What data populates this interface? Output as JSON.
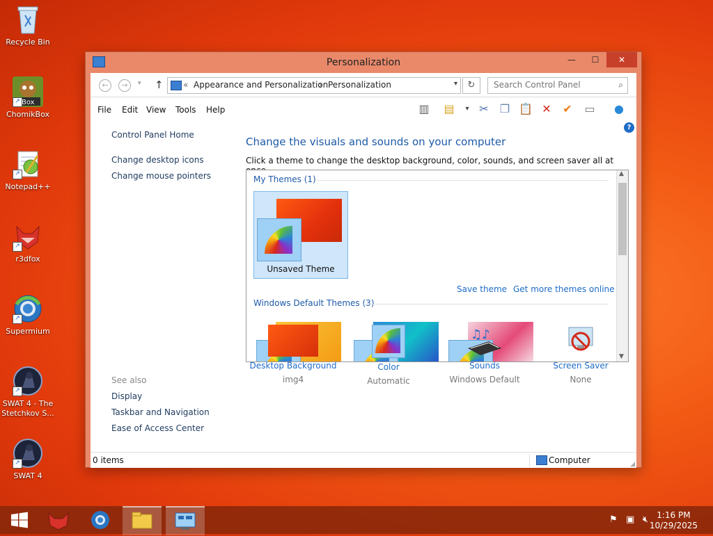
{
  "desktop": {
    "icons": [
      {
        "label": "Recycle Bin"
      },
      {
        "label": "ChomikBox"
      },
      {
        "label": "Notepad++"
      },
      {
        "label": "r3dfox"
      },
      {
        "label": "Supermium"
      },
      {
        "label": "SWAT 4 - The Stetchkov S..."
      },
      {
        "label": "SWAT 4"
      }
    ]
  },
  "window": {
    "title": "Personalization",
    "address": {
      "overflow": "«",
      "crumbs": [
        "Appearance and Personalization",
        "Personalization"
      ],
      "separator": "›"
    },
    "search_placeholder": "Search Control Panel",
    "menu": [
      "File",
      "Edit",
      "View",
      "Tools",
      "Help"
    ],
    "left_pane": {
      "links": [
        "Control Panel Home",
        "Change desktop icons",
        "Change mouse pointers"
      ],
      "see_also_label": "See also",
      "see_also": [
        "Display",
        "Taskbar and Navigation",
        "Ease of Access Center"
      ]
    },
    "main": {
      "heading": "Change the visuals and sounds on your computer",
      "subheading": "Click a theme to change the desktop background, color, sounds, and screen saver all at once.",
      "my_themes_header": "My Themes (1)",
      "selected_theme": "Unsaved Theme",
      "save_theme_link": "Save theme",
      "get_more_link": "Get more themes online",
      "default_themes_header": "Windows Default Themes (3)"
    },
    "bottom": [
      {
        "label": "Desktop Background",
        "value": "img4",
        "icon": "desktop-background-thumbnail"
      },
      {
        "label": "Color",
        "value": "Automatic",
        "icon": "color-fan-icon"
      },
      {
        "label": "Sounds",
        "value": "Windows Default",
        "icon": "music-notes-icon"
      },
      {
        "label": "Screen Saver",
        "value": "None",
        "icon": "no-screensaver-icon"
      }
    ],
    "status": {
      "items": "0 items",
      "location": "Computer"
    }
  },
  "taskbar": {
    "time": "1:16 PM",
    "date": "10/29/2025"
  },
  "colors": {
    "accent_window": "#e9896a",
    "link": "#1e6cc8",
    "heading": "#1e5aa8",
    "selection": "#cfe6fb"
  }
}
